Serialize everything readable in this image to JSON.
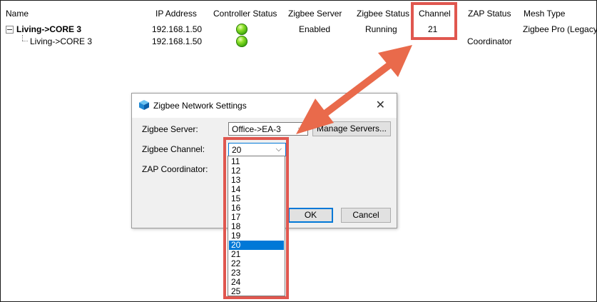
{
  "columns": [
    "Name",
    "IP Address",
    "Controller Status",
    "Zigbee Server",
    "Zigbee Status",
    "Channel",
    "ZAP Status",
    "Mesh Type"
  ],
  "rows": [
    {
      "name": "Living->CORE 3",
      "ip": "192.168.1.50",
      "zigbee_server": "Enabled",
      "zigbee_status": "Running",
      "channel": "21",
      "zap_status": "",
      "mesh_type": "Zigbee Pro (Legacy)"
    },
    {
      "name": "Living->CORE 3",
      "ip": "192.168.1.50",
      "zigbee_server": "",
      "zigbee_status": "",
      "channel": "",
      "zap_status": "Coordinator",
      "mesh_type": ""
    }
  ],
  "dialog": {
    "title": "Zigbee Network Settings",
    "server_label": "Zigbee Server:",
    "server_value": "Office->EA-3",
    "manage_servers": "Manage Servers...",
    "channel_label": "Zigbee Channel:",
    "channel_value": "20",
    "zap_label": "ZAP Coordinator:",
    "ok": "OK",
    "cancel": "Cancel",
    "channel_options": [
      "11",
      "12",
      "13",
      "14",
      "15",
      "16",
      "17",
      "18",
      "19",
      "20",
      "21",
      "22",
      "23",
      "24",
      "25"
    ],
    "selected_option": "20"
  },
  "colors": {
    "highlight": "#e0574f",
    "arrow": "#e96a4b",
    "selection": "#0078d7"
  }
}
